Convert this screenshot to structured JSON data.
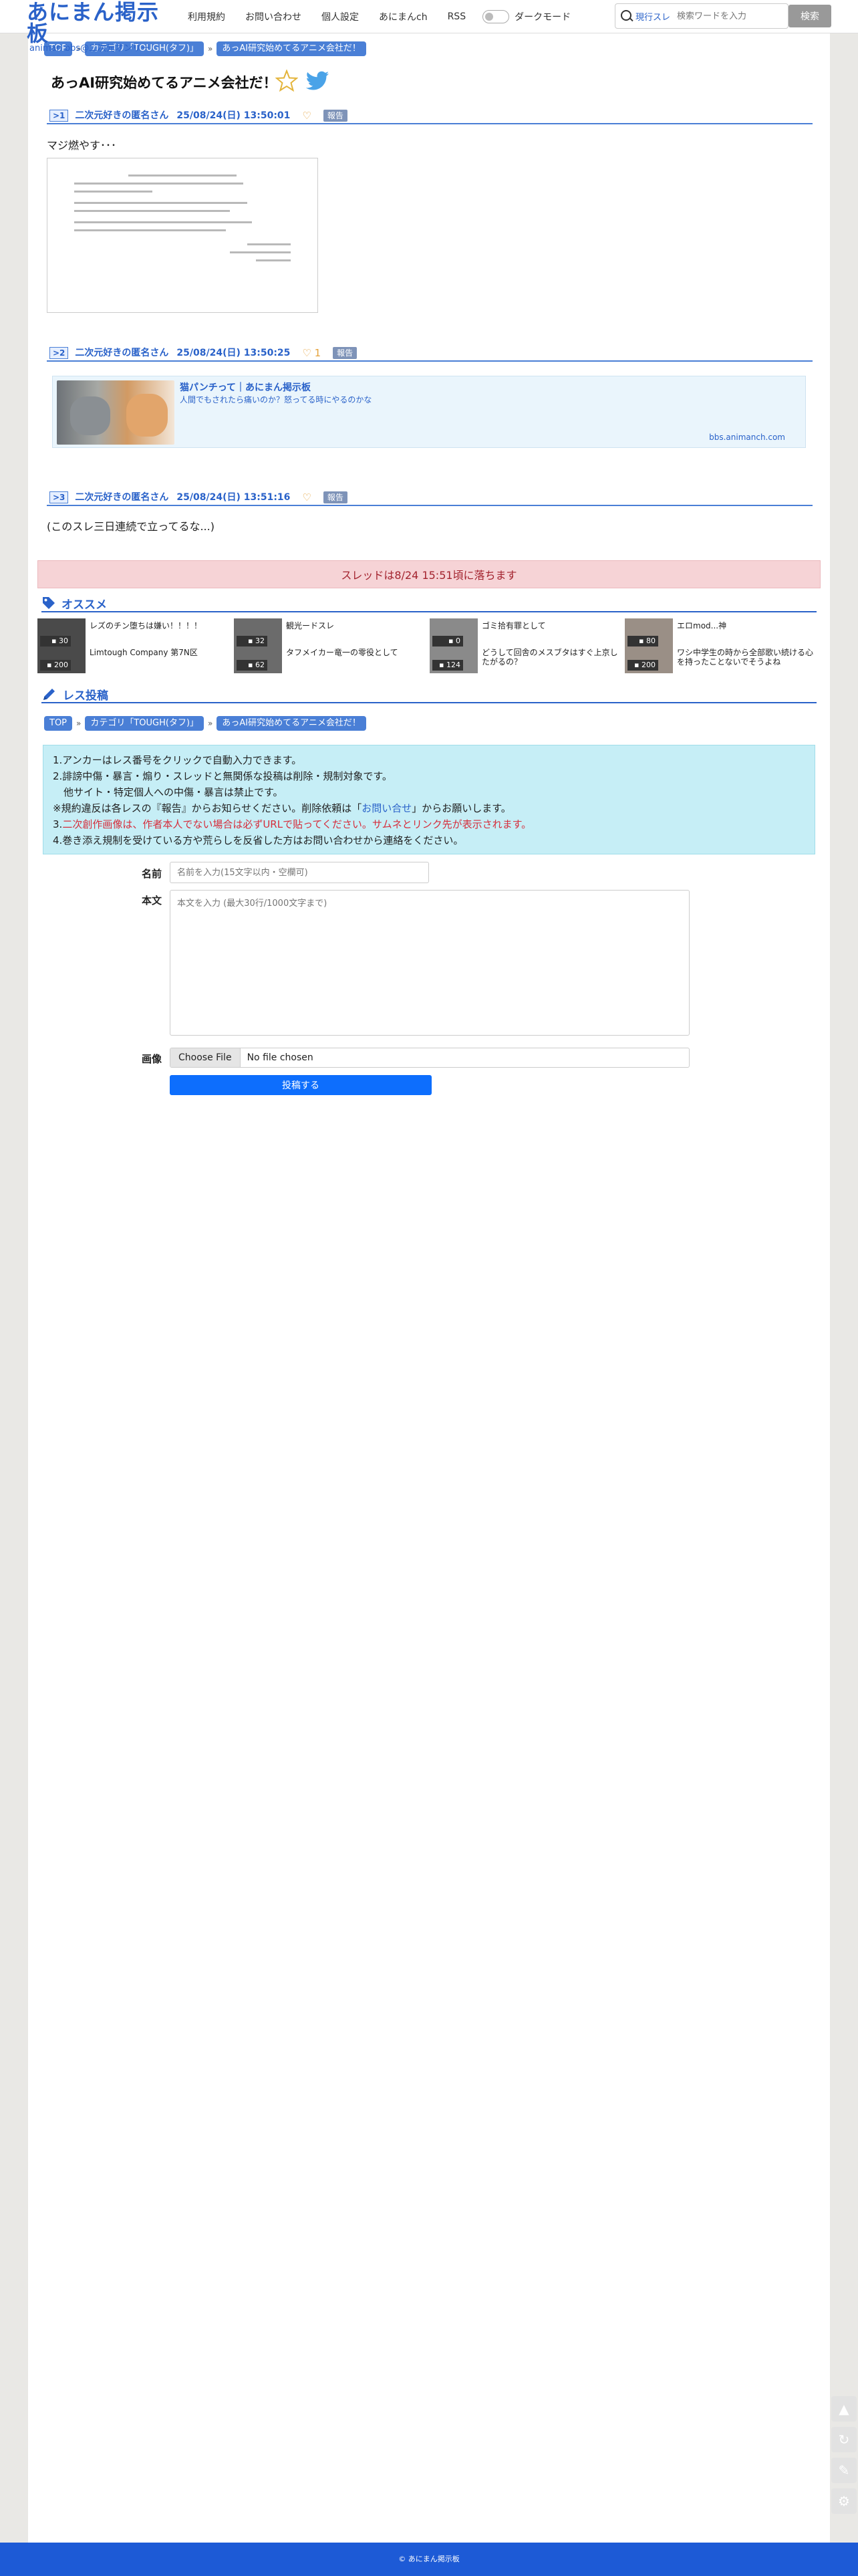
{
  "header": {
    "logo_main": "あにまん掲示板",
    "logo_sub": "animan bbs@二次元オンリー",
    "nav": [
      "利用規約",
      "お問い合わせ",
      "個人設定",
      "あにまんch",
      "RSS"
    ],
    "dark_mode_label": "ダークモード",
    "search_scope": "現行スレ",
    "search_placeholder": "検索ワードを入力",
    "search_button": "検索"
  },
  "breadcrumb": {
    "top": "TOP",
    "category": "カテゴリ「TOUGH(タフ)」",
    "thread": "あっAI研究始めてるアニメ会社だ！"
  },
  "thread": {
    "title": "あっAI研究始めてるアニメ会社だ！"
  },
  "posts": [
    {
      "num": ">1",
      "name": "二次元好きの匿名さん",
      "date": "25/08/24(日) 13:50:01",
      "likes": "",
      "report": "報告",
      "body": "マジ燃やす･･･"
    },
    {
      "num": ">2",
      "name": "二次元好きの匿名さん",
      "date": "25/08/24(日) 13:50:25",
      "likes": "1",
      "report": "報告",
      "link_title": "猫パンチって｜あにまん掲示板",
      "link_desc": "人間でもされたら痛いのか？怒ってる時にやるのかな",
      "link_domain": "bbs.animanch.com"
    },
    {
      "num": ">3",
      "name": "二次元好きの匿名さん",
      "date": "25/08/24(日) 13:51:16",
      "likes": "",
      "report": "報告",
      "body": "(このスレ三日連続で立ってるな...)"
    }
  ],
  "notice": "スレッドは8/24 15:51頃に落ちます",
  "recommend": {
    "heading": "オススメ",
    "items": [
      {
        "title": "レズのチン堕ちは嫌い！！！！",
        "count1": "30",
        "sub": "Limtough Company 第7N区",
        "count2": "200"
      },
      {
        "title": "観光ードスレ",
        "count1": "32",
        "sub": "タフメイカー竜一の零役として",
        "count2": "62"
      },
      {
        "title": "ゴミ拾有罪として",
        "count1": "0",
        "sub": "どうして回舎のメスブタはすぐ上京したがるの？",
        "count2": "124"
      },
      {
        "title": "エロmod...神",
        "count1": "80",
        "sub": "ワシ中学生の時から全部歌い続ける心を持ったことないでそうよね",
        "count2": "200"
      }
    ]
  },
  "reply": {
    "heading": "レス投稿",
    "rules": [
      "1.アンカーはレス番号をクリックで自動入力できます。",
      "2.誹謗中傷・暴言・煽り・スレッドと無関係な投稿は削除・規制対象です。",
      "他サイト・特定個人への中傷・暴言は禁止です。",
      "※規約違反は各レスの『報告』からお知らせください。削除依頼は「",
      "お問い合せ",
      "」からお願いします。",
      "3.",
      "二次創作画像は、作者本人でない場合は必ずURLで貼ってください。サムネとリンク先が表示されます。",
      "4.巻き添え規制を受けている方や荒らしを反省した方はお問い合わせから連絡をください。"
    ],
    "name_label": "名前",
    "name_placeholder": "名前を入力(15文字以内・空欄可)",
    "body_label": "本文",
    "body_placeholder": "本文を入力 (最大30行/1000文字まで)",
    "image_label": "画像",
    "file_button": "Choose File",
    "file_status": "No file chosen",
    "submit": "投稿する"
  },
  "footer": "© あにまん掲示板",
  "colors": {
    "accent": "#2a62c9",
    "footer": "#1d5ad6",
    "notice_bg": "#f6d3d6",
    "rules_bg": "#c6eef6"
  }
}
